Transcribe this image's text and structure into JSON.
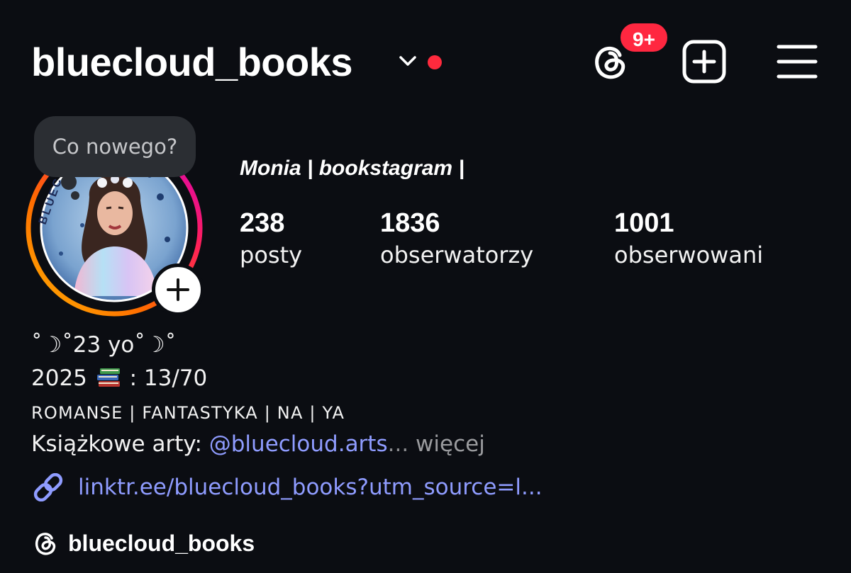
{
  "header": {
    "username": "bluecloud_books",
    "notifications_badge": "9+"
  },
  "avatar": {
    "note_bubble_text": "Co nowego?",
    "avatar_ring_text": "BLUEC"
  },
  "profile": {
    "display_name": "Monia | bookstagram |",
    "stats": [
      {
        "value": "238",
        "label": "posty"
      },
      {
        "value": "1836",
        "label": "obserwatorzy"
      },
      {
        "value": "1001",
        "label": "obserwowani"
      }
    ]
  },
  "bio": {
    "line1": "˚☽˚23 yo˚☽˚",
    "line2_prefix": "2025",
    "line2_suffix": ": 13/70",
    "line3": "ROMANSE | FANTASTYKA | NA | YA",
    "line4_prefix": "Książkowe arty: ",
    "line4_mention": "@bluecloud.arts",
    "line4_ellipsis": "...",
    "line4_more": " więcej",
    "link": "linktr.ee/bluecloud_books?utm_source=l...",
    "threads_handle": "bluecloud_books"
  },
  "icons": {
    "header": [
      "chevron-down-icon",
      "threads-icon",
      "create-post-icon",
      "menu-icon"
    ],
    "bio": [
      "books-emoji-icon",
      "link-icon",
      "threads-icon"
    ]
  },
  "colors": {
    "background": "#0b0d12",
    "badge": "#ff2740",
    "link": "#8f9cff",
    "bubble": "#2b2e33"
  }
}
